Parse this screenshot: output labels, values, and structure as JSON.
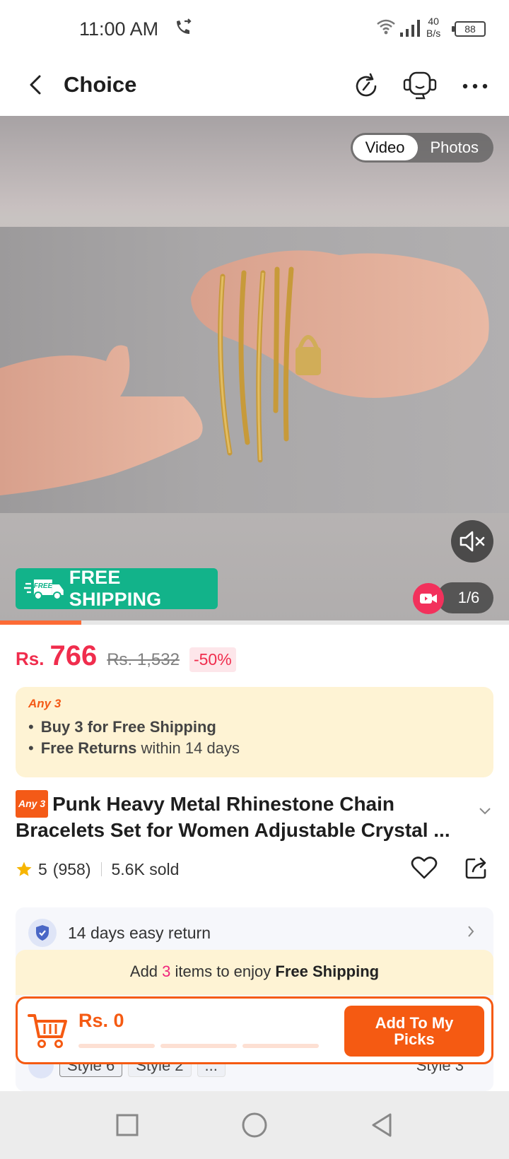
{
  "status_bar": {
    "time": "11:00 AM",
    "speed_value": "40",
    "speed_unit": "B/s",
    "battery": "88",
    "icons": [
      "call-forward-icon",
      "wifi-icon",
      "signal-icon",
      "battery-icon"
    ]
  },
  "header": {
    "title": "Choice",
    "icons": [
      "back-arrow-icon",
      "history-icon",
      "support-agent-icon",
      "more-icon"
    ]
  },
  "media": {
    "tabs": [
      {
        "label": "Video",
        "active": true
      },
      {
        "label": "Photos",
        "active": false
      }
    ],
    "free_shipping_label": "FREE SHIPPING",
    "truck_label": "FREE",
    "counter": "1/6",
    "progress": 0.16
  },
  "price": {
    "currency": "Rs.",
    "current": "766",
    "original": "Rs. 1,532",
    "discount": "-50%"
  },
  "promo": {
    "tag": "Any 3",
    "line1_bold": "Buy 3 for  Free Shipping",
    "line2_bold": "Free Returns",
    "line2_rest": "within 14 days"
  },
  "product": {
    "badge": "Any 3",
    "title": "Punk Heavy Metal Rhinestone Chain Bracelets Set for Women Adjustable Crystal ...",
    "rating": "5",
    "reviews": "(958)",
    "sold": "5.6K sold"
  },
  "service": {
    "return_text": "14 days easy return",
    "styles": [
      "Style 6",
      "Style 2",
      "..."
    ],
    "selected_style": "Style 3"
  },
  "free_shipping_bar": {
    "prefix": "Add",
    "count": "3",
    "middle": "items to enjoy",
    "bold": "Free Shipping"
  },
  "picks": {
    "total": "Rs. 0",
    "button_label": "Add To My Picks",
    "progress_segments": 3
  },
  "colors": {
    "accent": "#f55a12",
    "price": "#f02d4d",
    "free_shipping_badge": "#12b38a",
    "promo_bg": "#fef3d4"
  }
}
